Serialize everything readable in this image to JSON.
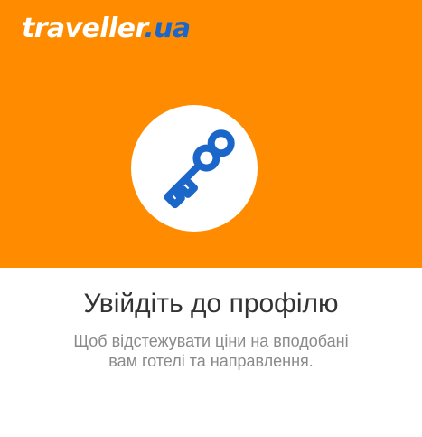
{
  "header": {
    "brand_name": "traveller",
    "brand_tld": ".ua",
    "colors": {
      "background": "#ff8c00",
      "brand_text": "#ffffff",
      "brand_tld": "#1a66c9",
      "icon": "#1a66c9"
    }
  },
  "hero_icon": "key-icon",
  "main": {
    "title": "Увійдіть до профілю",
    "subtitle_line1": "Щоб відстежувати ціни на вподобані",
    "subtitle_line2": "вам готелі та направлення."
  }
}
